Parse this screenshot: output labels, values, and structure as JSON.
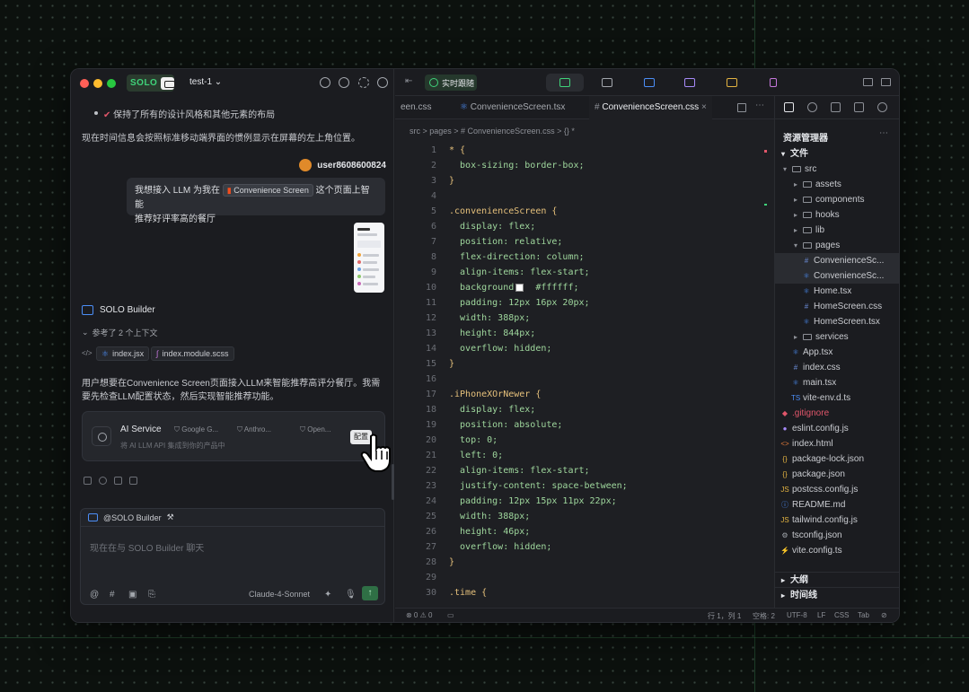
{
  "window": {
    "project": "test-1",
    "solo_badge": "SOLO"
  },
  "chat": {
    "lines": [
      "保持了所有的设计风格和其他元素的布局",
      "现在时间信息会按照标准移动端界面的惯例显示在屏幕的左上角位置。"
    ],
    "user_name": "user8608600824",
    "user_message_prefix": "我想接入 LLM 为我在",
    "user_message_chip": "Convenience Screen",
    "user_message_suffix": "这个页面上智能",
    "user_message_line2": "推荐好评率高的餐厅",
    "builder_name": "SOLO Builder",
    "ref_label": "参考了 2 个上下文",
    "ref_files": [
      "index.jsx",
      "index.module.scss"
    ],
    "assistant_text_1": "用户想要在Convenience Screen页面接入LLM来智能推荐高评分餐厅。我需",
    "assistant_text_2": "要先检查LLM配置状态，然后实现智能推荐功能。",
    "service": {
      "title": "AI Service",
      "tags": [
        "Google G...",
        "Anthro...",
        "Open..."
      ],
      "subtitle": "将 AI LLM API 集成到你的产品中",
      "button": "配置"
    },
    "input": {
      "mention": "@SOLO Builder",
      "placeholder": "现在在与 SOLO Builder 聊天",
      "model": "Claude-4-Sonnet",
      "icons": [
        "@",
        "#",
        "image-icon",
        "attach-icon"
      ]
    }
  },
  "toolbar": {
    "realtime_label": "实时跟随",
    "tab_colors": [
      "#3fd37a",
      "#a3a7ad",
      "#4c8ef7",
      "#a78bfa",
      "#e3b341",
      "#c678dd"
    ]
  },
  "editor": {
    "tabs": [
      "een.css",
      "ConvenienceScreen.tsx",
      "ConvenienceScreen.css"
    ],
    "active_tab": 2,
    "breadcrumb": "src  >  pages  >  # ConvenienceScreen.css  >  {} *",
    "code": [
      {
        "n": "1",
        "t": "* {"
      },
      {
        "n": "2",
        "t": "  box-sizing: border-box;"
      },
      {
        "n": "3",
        "t": "}"
      },
      {
        "n": "4",
        "t": ""
      },
      {
        "n": "5",
        "t": ".convenienceScreen {"
      },
      {
        "n": "6",
        "t": "  display: flex;"
      },
      {
        "n": "7",
        "t": "  position: relative;"
      },
      {
        "n": "8",
        "t": "  flex-direction: column;"
      },
      {
        "n": "9",
        "t": "  align-items: flex-start;"
      },
      {
        "n": "10",
        "t": "  background:   #ffffff;"
      },
      {
        "n": "11",
        "t": "  padding: 12px 16px 20px;"
      },
      {
        "n": "12",
        "t": "  width: 388px;"
      },
      {
        "n": "13",
        "t": "  height: 844px;"
      },
      {
        "n": "14",
        "t": "  overflow: hidden;"
      },
      {
        "n": "15",
        "t": "}"
      },
      {
        "n": "16",
        "t": ""
      },
      {
        "n": "17",
        "t": ".iPhoneXOrNewer {"
      },
      {
        "n": "18",
        "t": "  display: flex;"
      },
      {
        "n": "19",
        "t": "  position: absolute;"
      },
      {
        "n": "20",
        "t": "  top: 0;"
      },
      {
        "n": "21",
        "t": "  left: 0;"
      },
      {
        "n": "22",
        "t": "  align-items: flex-start;"
      },
      {
        "n": "23",
        "t": "  justify-content: space-between;"
      },
      {
        "n": "24",
        "t": "  padding: 12px 15px 11px 22px;"
      },
      {
        "n": "25",
        "t": "  width: 388px;"
      },
      {
        "n": "26",
        "t": "  height: 46px;"
      },
      {
        "n": "27",
        "t": "  overflow: hidden;"
      },
      {
        "n": "28",
        "t": "}"
      },
      {
        "n": "29",
        "t": ""
      },
      {
        "n": "30",
        "t": ".time {"
      }
    ]
  },
  "explorer": {
    "title": "资源管理器",
    "section_files": "文件",
    "items": [
      {
        "label": "src",
        "icon": "▾",
        "depth": 0
      },
      {
        "label": "assets",
        "icon": "▸",
        "depth": 1
      },
      {
        "label": "components",
        "icon": "▸",
        "depth": 1
      },
      {
        "label": "hooks",
        "icon": "▸",
        "depth": 1
      },
      {
        "label": "lib",
        "icon": "▸",
        "depth": 1
      },
      {
        "label": "pages",
        "icon": "▾",
        "depth": 1
      },
      {
        "label": "ConvenienceSc...",
        "icon": "#",
        "depth": 2
      },
      {
        "label": "ConvenienceSc...",
        "icon": "⚛",
        "depth": 2
      },
      {
        "label": "Home.tsx",
        "icon": "⚛",
        "depth": 2
      },
      {
        "label": "HomeScreen.css",
        "icon": "#",
        "depth": 2
      },
      {
        "label": "HomeScreen.tsx",
        "icon": "⚛",
        "depth": 2
      },
      {
        "label": "services",
        "icon": "▸",
        "depth": 1
      },
      {
        "label": "App.tsx",
        "icon": "⚛",
        "depth": 1
      },
      {
        "label": "index.css",
        "icon": "#",
        "depth": 1
      },
      {
        "label": "main.tsx",
        "icon": "⚛",
        "depth": 1
      },
      {
        "label": "vite-env.d.ts",
        "icon": "TS",
        "depth": 1
      },
      {
        "label": ".gitignore",
        "icon": "◆",
        "depth": 0
      },
      {
        "label": "eslint.config.js",
        "icon": "●",
        "depth": 0
      },
      {
        "label": "index.html",
        "icon": "<>",
        "depth": 0
      },
      {
        "label": "package-lock.json",
        "icon": "{}",
        "depth": 0
      },
      {
        "label": "package.json",
        "icon": "{}",
        "depth": 0
      },
      {
        "label": "postcss.config.js",
        "icon": "JS",
        "depth": 0
      },
      {
        "label": "README.md",
        "icon": "ⓘ",
        "depth": 0
      },
      {
        "label": "tailwind.config.js",
        "icon": "JS",
        "depth": 0
      },
      {
        "label": "tsconfig.json",
        "icon": "⚙",
        "depth": 0
      },
      {
        "label": "vite.config.ts",
        "icon": "⚡",
        "depth": 0
      }
    ],
    "section_outline": "大纲",
    "section_timeline": "时间线"
  },
  "status": {
    "problems": "⊗ 0 ⚠ 0",
    "position": "行 1，列 1",
    "spaces": "空格: 2",
    "encoding": "UTF-8",
    "eol": "LF",
    "language": "CSS",
    "tab": "Tab"
  }
}
